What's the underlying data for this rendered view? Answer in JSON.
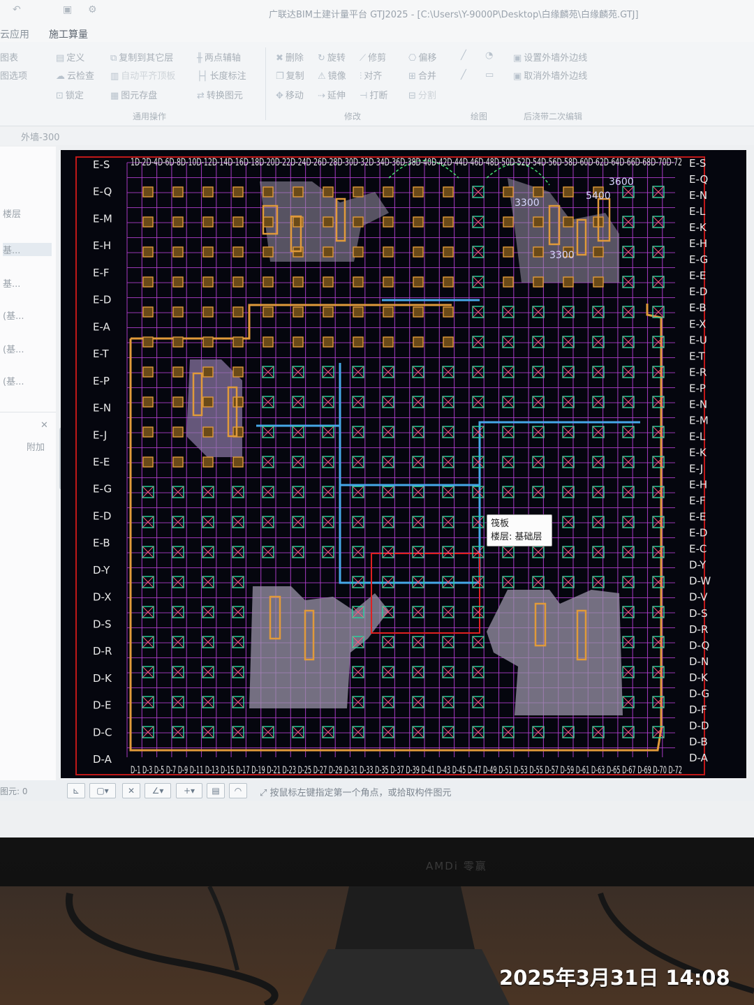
{
  "window": {
    "title": "广联达BIM土建计量平台 GTJ2025 - [C:\\Users\\Y-9000P\\Desktop\\白缘麟苑\\白缘麟苑.GTJ]",
    "tabs": [
      "云应用",
      "施工算量"
    ]
  },
  "ribbon": {
    "col1": [
      "图表",
      "图选项"
    ],
    "general": [
      "定义",
      "云检查",
      "锁定",
      "复制到其它层",
      "自动平齐顶板",
      "图元存盘",
      "两点辅轴",
      "长度标注",
      "转换图元"
    ],
    "general_group": "通用操作",
    "modify": [
      "删除",
      "旋转",
      "修剪",
      "偏移",
      "复制",
      "镜像",
      "对齐",
      "合并",
      "移动",
      "延伸",
      "打断",
      "分割"
    ],
    "modify_group": "修改",
    "draw_group": "绘图",
    "edit": [
      "设置外墙外边线",
      "取消外墙外边线"
    ],
    "edit_group": "后浇带二次编辑"
  },
  "property_bar": {
    "component": "外墙-300"
  },
  "left_panel": {
    "items": [
      "楼层",
      "基...",
      "基...",
      "(基...",
      "(基...",
      "(基..."
    ],
    "attach_label": "附加"
  },
  "cad": {
    "tooltip": {
      "line1": "筏板",
      "line2": "楼层: 基础层"
    },
    "right_axis_labels": [
      "E-S",
      "E-Q",
      "E-N",
      "E-L",
      "E-K",
      "E-H",
      "E-G",
      "E-E",
      "E-D",
      "E-B",
      "E-X",
      "E-U",
      "E-T",
      "E-R",
      "E-P",
      "E-N",
      "E-M",
      "E-L",
      "E-K",
      "E-J",
      "E-H",
      "E-F",
      "E-E",
      "E-D",
      "E-C",
      "D-Y",
      "D-W",
      "D-V",
      "D-S",
      "D-R",
      "D-Q",
      "D-N",
      "D-K",
      "D-G",
      "D-F",
      "D-D",
      "D-B",
      "D-A"
    ],
    "left_axis_labels": [
      "E-S",
      "E-Q",
      "E-M",
      "E-H",
      "E-F",
      "E-D",
      "E-A",
      "E-T",
      "E-P",
      "E-N",
      "E-J",
      "E-E",
      "E-G",
      "E-D",
      "E-B",
      "D-Y",
      "D-X",
      "D-S",
      "D-R",
      "D-K",
      "D-E",
      "D-C",
      "D-A"
    ],
    "top_axis_text": "1D-2D-4D-6D-8D-10D-12D-14D-16D-18D-20D-22D-24D-26D-28D-30D-32D-34D-36D-38D-40D-42D-44D-46D-48D-50D-52D-54D-56D-58D-60D-62D-64D-66D-68D-70D-72",
    "bottom_axis_text": "D-1 D-3 D-5 D-7 D-9 D-11 D-13 D-15 D-17 D-19 D-21 D-23 D-25 D-27 D-29 D-31 D-33 D-35 D-37 D-39 D-41 D-43 D-45 D-47 D-49 D-51 D-53 D-55 D-57 D-59 D-61 D-63 D-65 D-67 D-69 D-70 D-72",
    "dims": [
      "5400",
      "3300",
      "3300",
      "3600"
    ]
  },
  "status_bar": {
    "count": "图元: 0",
    "hint": "按鼠标左键指定第一个角点，或拾取构件图元"
  },
  "monitor": {
    "brand": "AMDi 零赢"
  },
  "photo": {
    "timestamp": "2025年3月31日 14:08"
  },
  "colors": {
    "grid": "#b23fd0",
    "cap": "#28d6a0",
    "wall": "#e09a3a",
    "beam": "#46a8e8",
    "slab": "#9a93a8",
    "bg": "#05060e"
  }
}
